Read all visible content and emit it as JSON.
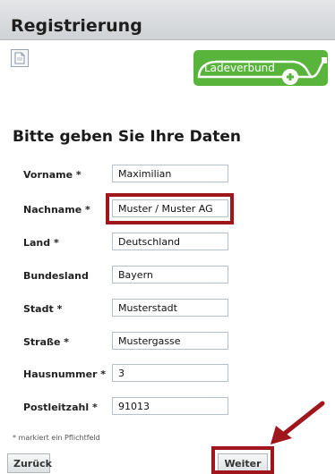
{
  "header": {
    "title": "Registrierung"
  },
  "logo": {
    "text": "Ladeverbund",
    "color": "#59b43c"
  },
  "form": {
    "heading": "Bitte geben Sie Ihre Daten",
    "fields": [
      {
        "label": "Vorname *",
        "value": "Maximilian"
      },
      {
        "label": "Nachname *",
        "value": "Muster / Muster AG"
      },
      {
        "label": "Land *",
        "value": "Deutschland"
      },
      {
        "label": "Bundesland",
        "value": "Bayern"
      },
      {
        "label": "Stadt *",
        "value": "Musterstadt"
      },
      {
        "label": "Straße *",
        "value": "Mustergasse"
      },
      {
        "label": "Hausnummer *",
        "value": "3"
      },
      {
        "label": "Postleitzahl *",
        "value": "91013"
      }
    ],
    "required_hint": "* markiert ein Pflichtfeld"
  },
  "buttons": {
    "back_label": "Zurück",
    "next_label": "Weiter"
  },
  "annotation": {
    "color": "#a0161d"
  }
}
